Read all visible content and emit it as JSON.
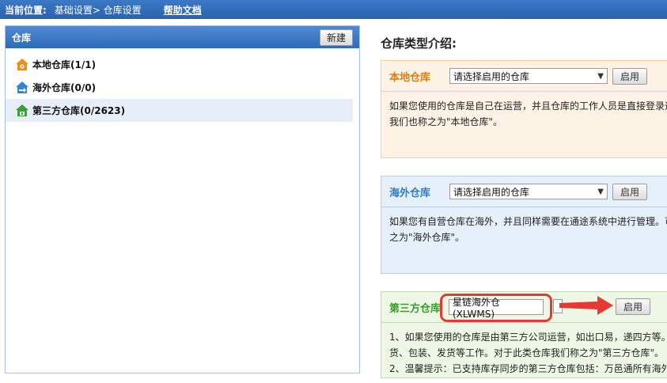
{
  "breadcrumb": {
    "label": "当前位置:",
    "path": "基础设置> 仓库设置",
    "help": "帮助文档"
  },
  "left_panel": {
    "title": "仓库",
    "new_button": "新建",
    "items": [
      {
        "label": "本地仓库(1/1)",
        "icon": "local-warehouse-icon",
        "color": "#e8901f"
      },
      {
        "label": "海外仓库(0/0)",
        "icon": "overseas-warehouse-icon",
        "color": "#2f86d6"
      },
      {
        "label": "第三方仓库(0/2623)",
        "icon": "third-party-warehouse-icon",
        "color": "#3aa036"
      }
    ]
  },
  "right": {
    "title": "仓库类型介绍:",
    "enable_label": "启用",
    "local": {
      "title": "本地仓库",
      "select_value": "请选择启用的仓库",
      "lines": [
        "如果您使用的仓库是自己在运营，并且仓库的工作人员是直接登录通",
        "我们也称之为\"本地仓库\"。"
      ]
    },
    "overseas": {
      "title": "海外仓库",
      "select_value": "请选择启用的仓库",
      "lines": [
        "如果您有自营仓库在海外，并且同样需要在通途系统中进行管理。可",
        "之为\"海外仓库\"。"
      ]
    },
    "third": {
      "title": "第三方仓库",
      "select_value": "星链海外仓(XLWMS)",
      "lines": [
        "1、如果您使用的仓库是由第三方公司运营，如出口易，递四方等。",
        "货、包装、发货等工作。对于此类仓库我们称之为\"第三方仓库\"。",
        "2、温馨提示：已支持库存同步的第三方仓库包括：万邑通所有海外"
      ]
    }
  }
}
